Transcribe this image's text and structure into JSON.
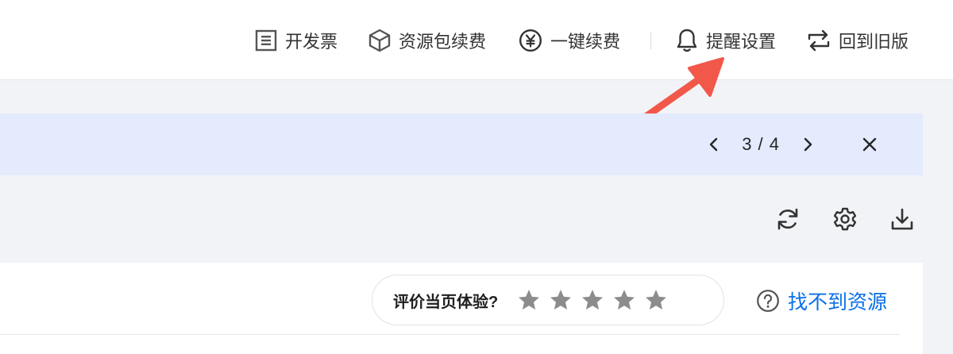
{
  "header": {
    "items": [
      {
        "label": "开发票",
        "icon": "invoice-icon"
      },
      {
        "label": "资源包续费",
        "icon": "package-cube-icon"
      },
      {
        "label": "一键续费",
        "icon": "yen-circle-icon"
      },
      {
        "label": "提醒设置",
        "icon": "bell-icon"
      },
      {
        "label": "回到旧版",
        "icon": "switch-arrows-icon"
      }
    ]
  },
  "banner": {
    "current": 3,
    "total": 4,
    "counter_text": "3 / 4",
    "prev_icon": "chevron-left-icon",
    "next_icon": "chevron-right-icon",
    "close_icon": "close-icon",
    "background": "#e3ebfd"
  },
  "toolbar": {
    "icons": [
      "refresh-icon",
      "gear-icon",
      "download-icon"
    ]
  },
  "feedback": {
    "rating_label": "评价当页体验?",
    "stars_total": 5,
    "stars_filled": 0,
    "star_color": "#8c8c8c",
    "help_label": "找不到资源",
    "help_icon": "question-circle-icon",
    "link_color": "#0a6fe8"
  },
  "annotation": {
    "arrow_color": "#f2584a",
    "points_to": "提醒设置"
  }
}
